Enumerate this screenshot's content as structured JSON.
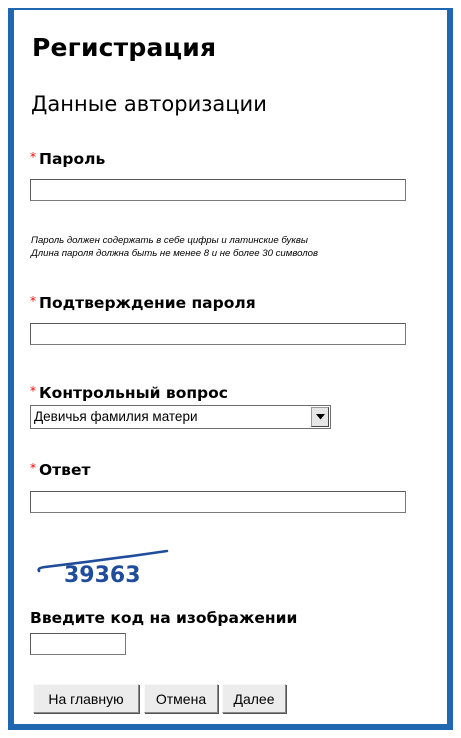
{
  "header": {
    "title": "Регистрация",
    "subtitle": "Данные авторизации"
  },
  "form": {
    "required_mark": "*",
    "password": {
      "label": "Пароль",
      "value": ""
    },
    "hint_line1": "Пароль должен содержать в себе цифры и латинские буквы",
    "hint_line2": "Длина пароля должна быть не менее 8 и не более 30 символов",
    "confirm": {
      "label": "Подтверждение пароля",
      "value": ""
    },
    "question": {
      "label": "Контрольный вопрос",
      "selected": "Девичья фамилия матери"
    },
    "answer": {
      "label": "Ответ",
      "value": ""
    },
    "captcha": {
      "code": "39363",
      "color": "#1f4d9c",
      "label": "Введите код на изображении",
      "value": ""
    }
  },
  "buttons": {
    "home": "На главную",
    "cancel": "Отмена",
    "next": "Далее"
  },
  "colors": {
    "frame": "#1f67b1",
    "required": "#ff0000"
  }
}
